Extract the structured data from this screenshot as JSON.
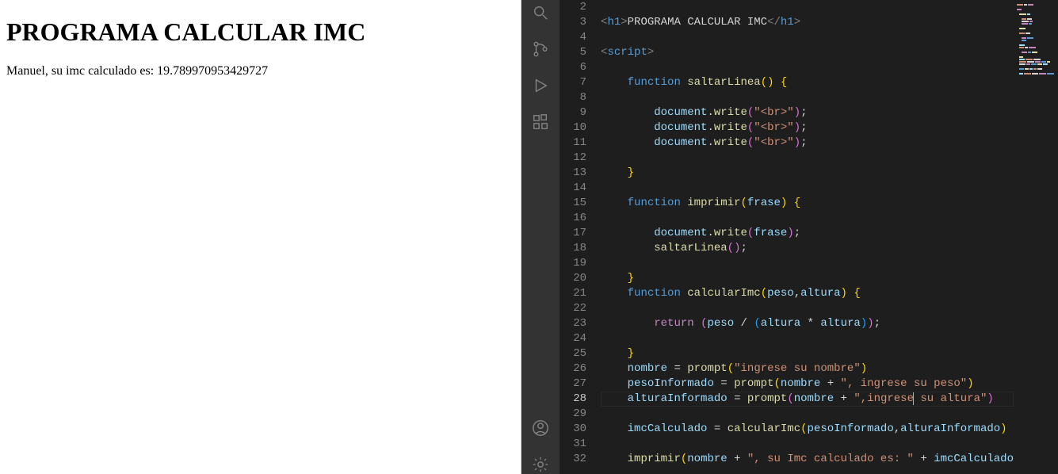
{
  "browser": {
    "heading": "PROGRAMA CALCULAR IMC",
    "output": "Manuel, su imc calculado es: 19.789970953429727"
  },
  "editor": {
    "visible_start_line": 2,
    "active_line": 28,
    "lines": {
      "2": "",
      "3": "<h1>PROGRAMA CALCULAR IMC</h1>",
      "4": "",
      "5": "<script>",
      "6": "",
      "7": "    function saltarLinea() {",
      "8": "",
      "9": "        document.write(\"<br>\");",
      "10": "        document.write(\"<br>\");",
      "11": "        document.write(\"<br>\");",
      "12": "",
      "13": "    }",
      "14": "",
      "15": "    function imprimir(frase) {",
      "16": "",
      "17": "        document.write(frase);",
      "18": "        saltarLinea();",
      "19": "",
      "20": "    }",
      "21": "    function calcularImc(peso,altura) {",
      "22": "",
      "23": "        return (peso / (altura * altura));",
      "24": "",
      "25": "    }",
      "26": "    nombre = prompt(\"ingrese su nombre\")",
      "27": "    pesoInformado = prompt(nombre + \", ingrese su peso\")",
      "28": "    alturaInformado = prompt(nombre + \",ingrese su altura\")",
      "29": "",
      "30": "    imcCalculado = calcularImc(pesoInformado,alturaInformado)",
      "31": "",
      "32": "    imprimir(nombre + \", su Imc calculado es: \" + imcCalculado"
    }
  },
  "activity_bar": {
    "icons": [
      "search-icon",
      "source-control-icon",
      "run-debug-icon",
      "extensions-icon",
      "account-icon",
      "settings-gear-icon"
    ]
  }
}
